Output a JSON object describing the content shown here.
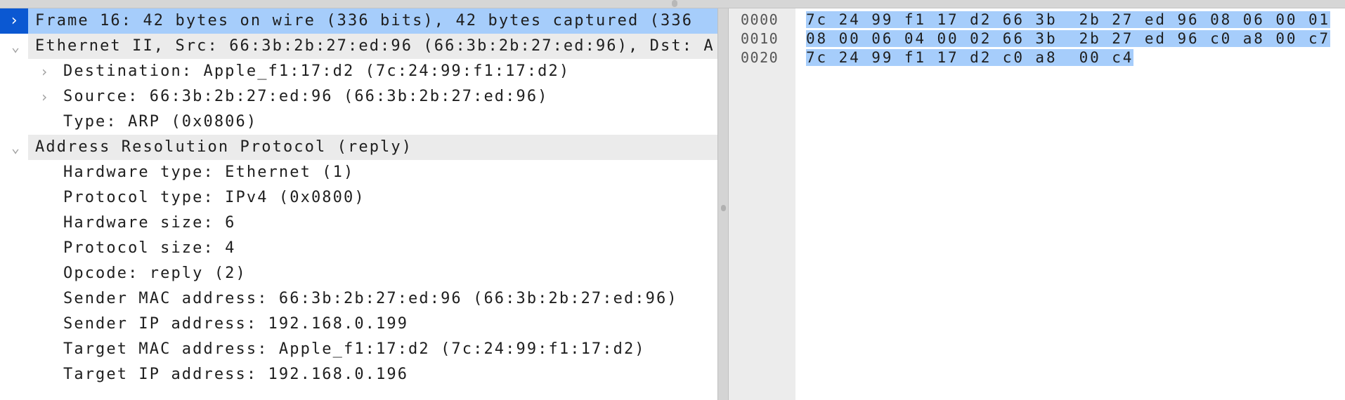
{
  "tree": [
    {
      "text": "Frame 16: 42 bytes on wire (336 bits), 42 bytes captured (336",
      "level": 0,
      "state": "collapsed",
      "selected": true
    },
    {
      "text": "Ethernet II, Src: 66:3b:2b:27:ed:96 (66:3b:2b:27:ed:96), Dst: A",
      "level": 0,
      "state": "expanded"
    },
    {
      "text": "Destination: Apple_f1:17:d2 (7c:24:99:f1:17:d2)",
      "level": 1,
      "state": "collapsed"
    },
    {
      "text": "Source: 66:3b:2b:27:ed:96 (66:3b:2b:27:ed:96)",
      "level": 1,
      "state": "collapsed"
    },
    {
      "text": "Type: ARP (0x0806)",
      "level": 1,
      "state": "leaf"
    },
    {
      "text": "Address Resolution Protocol (reply)",
      "level": 0,
      "state": "expanded"
    },
    {
      "text": "Hardware type: Ethernet (1)",
      "level": 1,
      "state": "leaf"
    },
    {
      "text": "Protocol type: IPv4 (0x0800)",
      "level": 1,
      "state": "leaf"
    },
    {
      "text": "Hardware size: 6",
      "level": 1,
      "state": "leaf"
    },
    {
      "text": "Protocol size: 4",
      "level": 1,
      "state": "leaf"
    },
    {
      "text": "Opcode: reply (2)",
      "level": 1,
      "state": "leaf"
    },
    {
      "text": "Sender MAC address: 66:3b:2b:27:ed:96 (66:3b:2b:27:ed:96)",
      "level": 1,
      "state": "leaf"
    },
    {
      "text": "Sender IP address: 192.168.0.199",
      "level": 1,
      "state": "leaf"
    },
    {
      "text": "Target MAC address: Apple_f1:17:d2 (7c:24:99:f1:17:d2)",
      "level": 1,
      "state": "leaf"
    },
    {
      "text": "Target IP address: 192.168.0.196",
      "level": 1,
      "state": "leaf"
    }
  ],
  "hex_dump": [
    {
      "offset": "0000",
      "bytes": "7c 24 99 f1 17 d2 66 3b  2b 27 ed 96 08 06 00 01"
    },
    {
      "offset": "0010",
      "bytes": "08 00 06 04 00 02 66 3b  2b 27 ed 96 c0 a8 00 c7"
    },
    {
      "offset": "0020",
      "bytes": "7c 24 99 f1 17 d2 c0 a8  00 c4"
    }
  ],
  "colors": {
    "selection": "#a6cdfb",
    "selected_chevron_bg": "#0b58d2",
    "header_bg": "#ebebeb"
  }
}
